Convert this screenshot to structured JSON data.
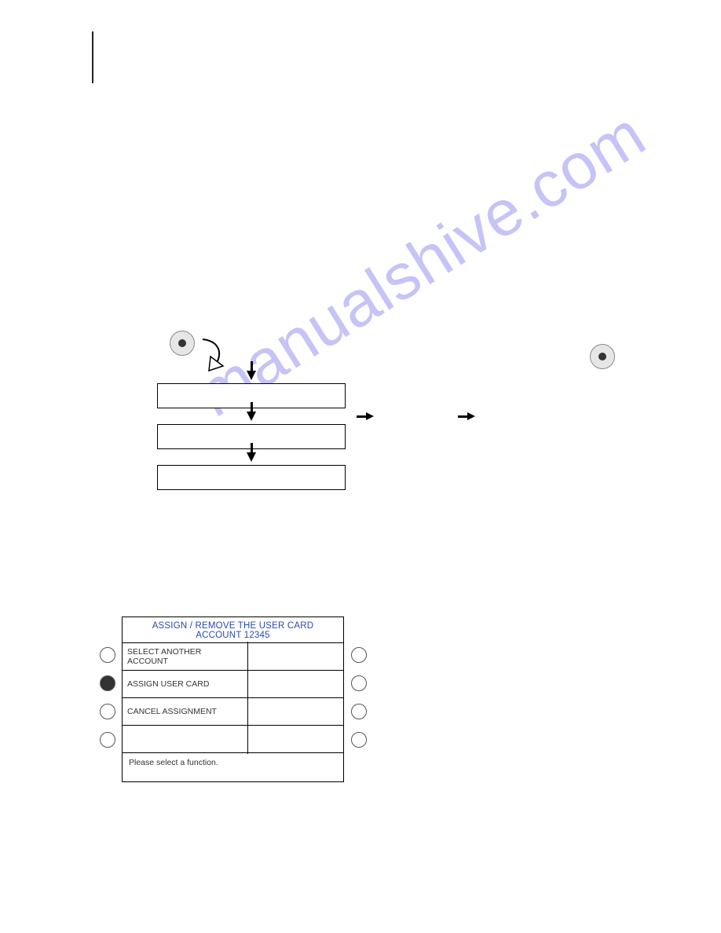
{
  "watermark_text": "manualshive.com",
  "diagram": {
    "boxes": [
      "",
      "",
      ""
    ],
    "right_labels": {
      "a": "",
      "b": ""
    }
  },
  "screen": {
    "title_line1": "ASSIGN / REMOVE THE USER CARD",
    "title_line2": "ACCOUNT 12345",
    "rows": [
      {
        "label": "SELECT ANOTHER ACCOUNT",
        "selected": false
      },
      {
        "label": "ASSIGN USER CARD",
        "selected": true
      },
      {
        "label": "CANCEL ASSIGNMENT",
        "selected": false
      },
      {
        "label": "",
        "selected": false
      }
    ],
    "footer": "Please select a function."
  }
}
